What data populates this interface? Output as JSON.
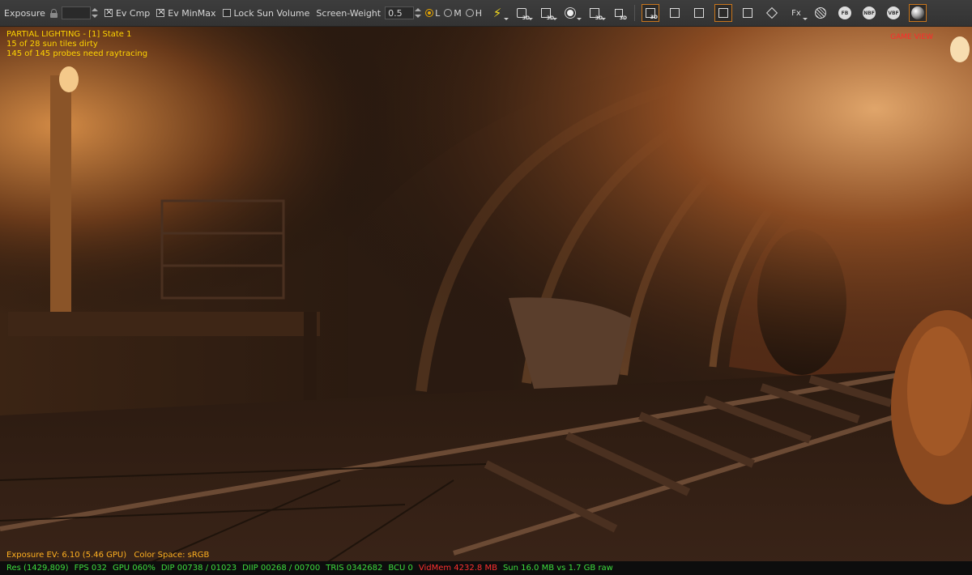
{
  "toolbar": {
    "exposure_label": "Exposure",
    "exposure_value": "",
    "ev_cmp_label": "Ev Cmp",
    "ev_cmp_checked": true,
    "ev_minmax_label": "Ev MinMax",
    "ev_minmax_checked": true,
    "lock_sun_volume_label": "Lock Sun Volume",
    "lock_sun_volume_checked": false,
    "screen_weight_label": "Screen-Weight",
    "screen_weight_value": "0.5",
    "quality_options": [
      {
        "label": "L",
        "selected": true
      },
      {
        "label": "M",
        "selected": false
      },
      {
        "label": "H",
        "selected": false
      }
    ],
    "icons": [
      {
        "name": "lightning-icon",
        "text": "⚡"
      },
      {
        "name": "camera-3d-icon",
        "text": "3D"
      },
      {
        "name": "screen-3d-icon",
        "text": "3D"
      },
      {
        "name": "light-bulb-icon",
        "text": ""
      },
      {
        "name": "view-3d-icon",
        "text": "3D"
      },
      {
        "name": "lock-3d-icon",
        "text": "3D"
      },
      {
        "name": "transform-3d-icon",
        "text": "3D"
      },
      {
        "name": "transform-icon",
        "text": ""
      },
      {
        "name": "add-transform-icon",
        "text": ""
      },
      {
        "name": "frame-icon",
        "text": ""
      },
      {
        "name": "crop-icon",
        "text": ""
      },
      {
        "name": "brush-icon",
        "text": ""
      },
      {
        "name": "fx-icon",
        "text": "Fx"
      },
      {
        "name": "wireframe-sphere-icon",
        "text": ""
      },
      {
        "name": "fb-icon",
        "text": "FB"
      },
      {
        "name": "nbf-icon",
        "text": "NBF"
      },
      {
        "name": "vbf-icon",
        "text": "VBF"
      },
      {
        "name": "shaded-sphere-icon",
        "text": ""
      }
    ],
    "accent_color": "#c9761c"
  },
  "viewport": {
    "status_title": "PARTIAL LIGHTING - [1] State 1",
    "sun_tiles": "15 of 28 sun tiles dirty",
    "probes": "145 of 145 probes need raytracing",
    "game_view": "GAME VIEW",
    "exposure_ev": "Exposure EV: 6.10 (5.46 GPU)",
    "color_space": "Color Space: sRGB"
  },
  "stats": {
    "res": "Res (1429,809)",
    "fps": "FPS 032",
    "gpu": "GPU 060%",
    "dip": "DIP 00738 / 01023",
    "diip": "DIIP 00268 / 00700",
    "tris": "TRIS 0342682",
    "bcu": "BCU 0",
    "vidmem": "VidMem 4232.8 MB",
    "sun": "Sun 16.0 MB vs 1.7 GB raw"
  }
}
